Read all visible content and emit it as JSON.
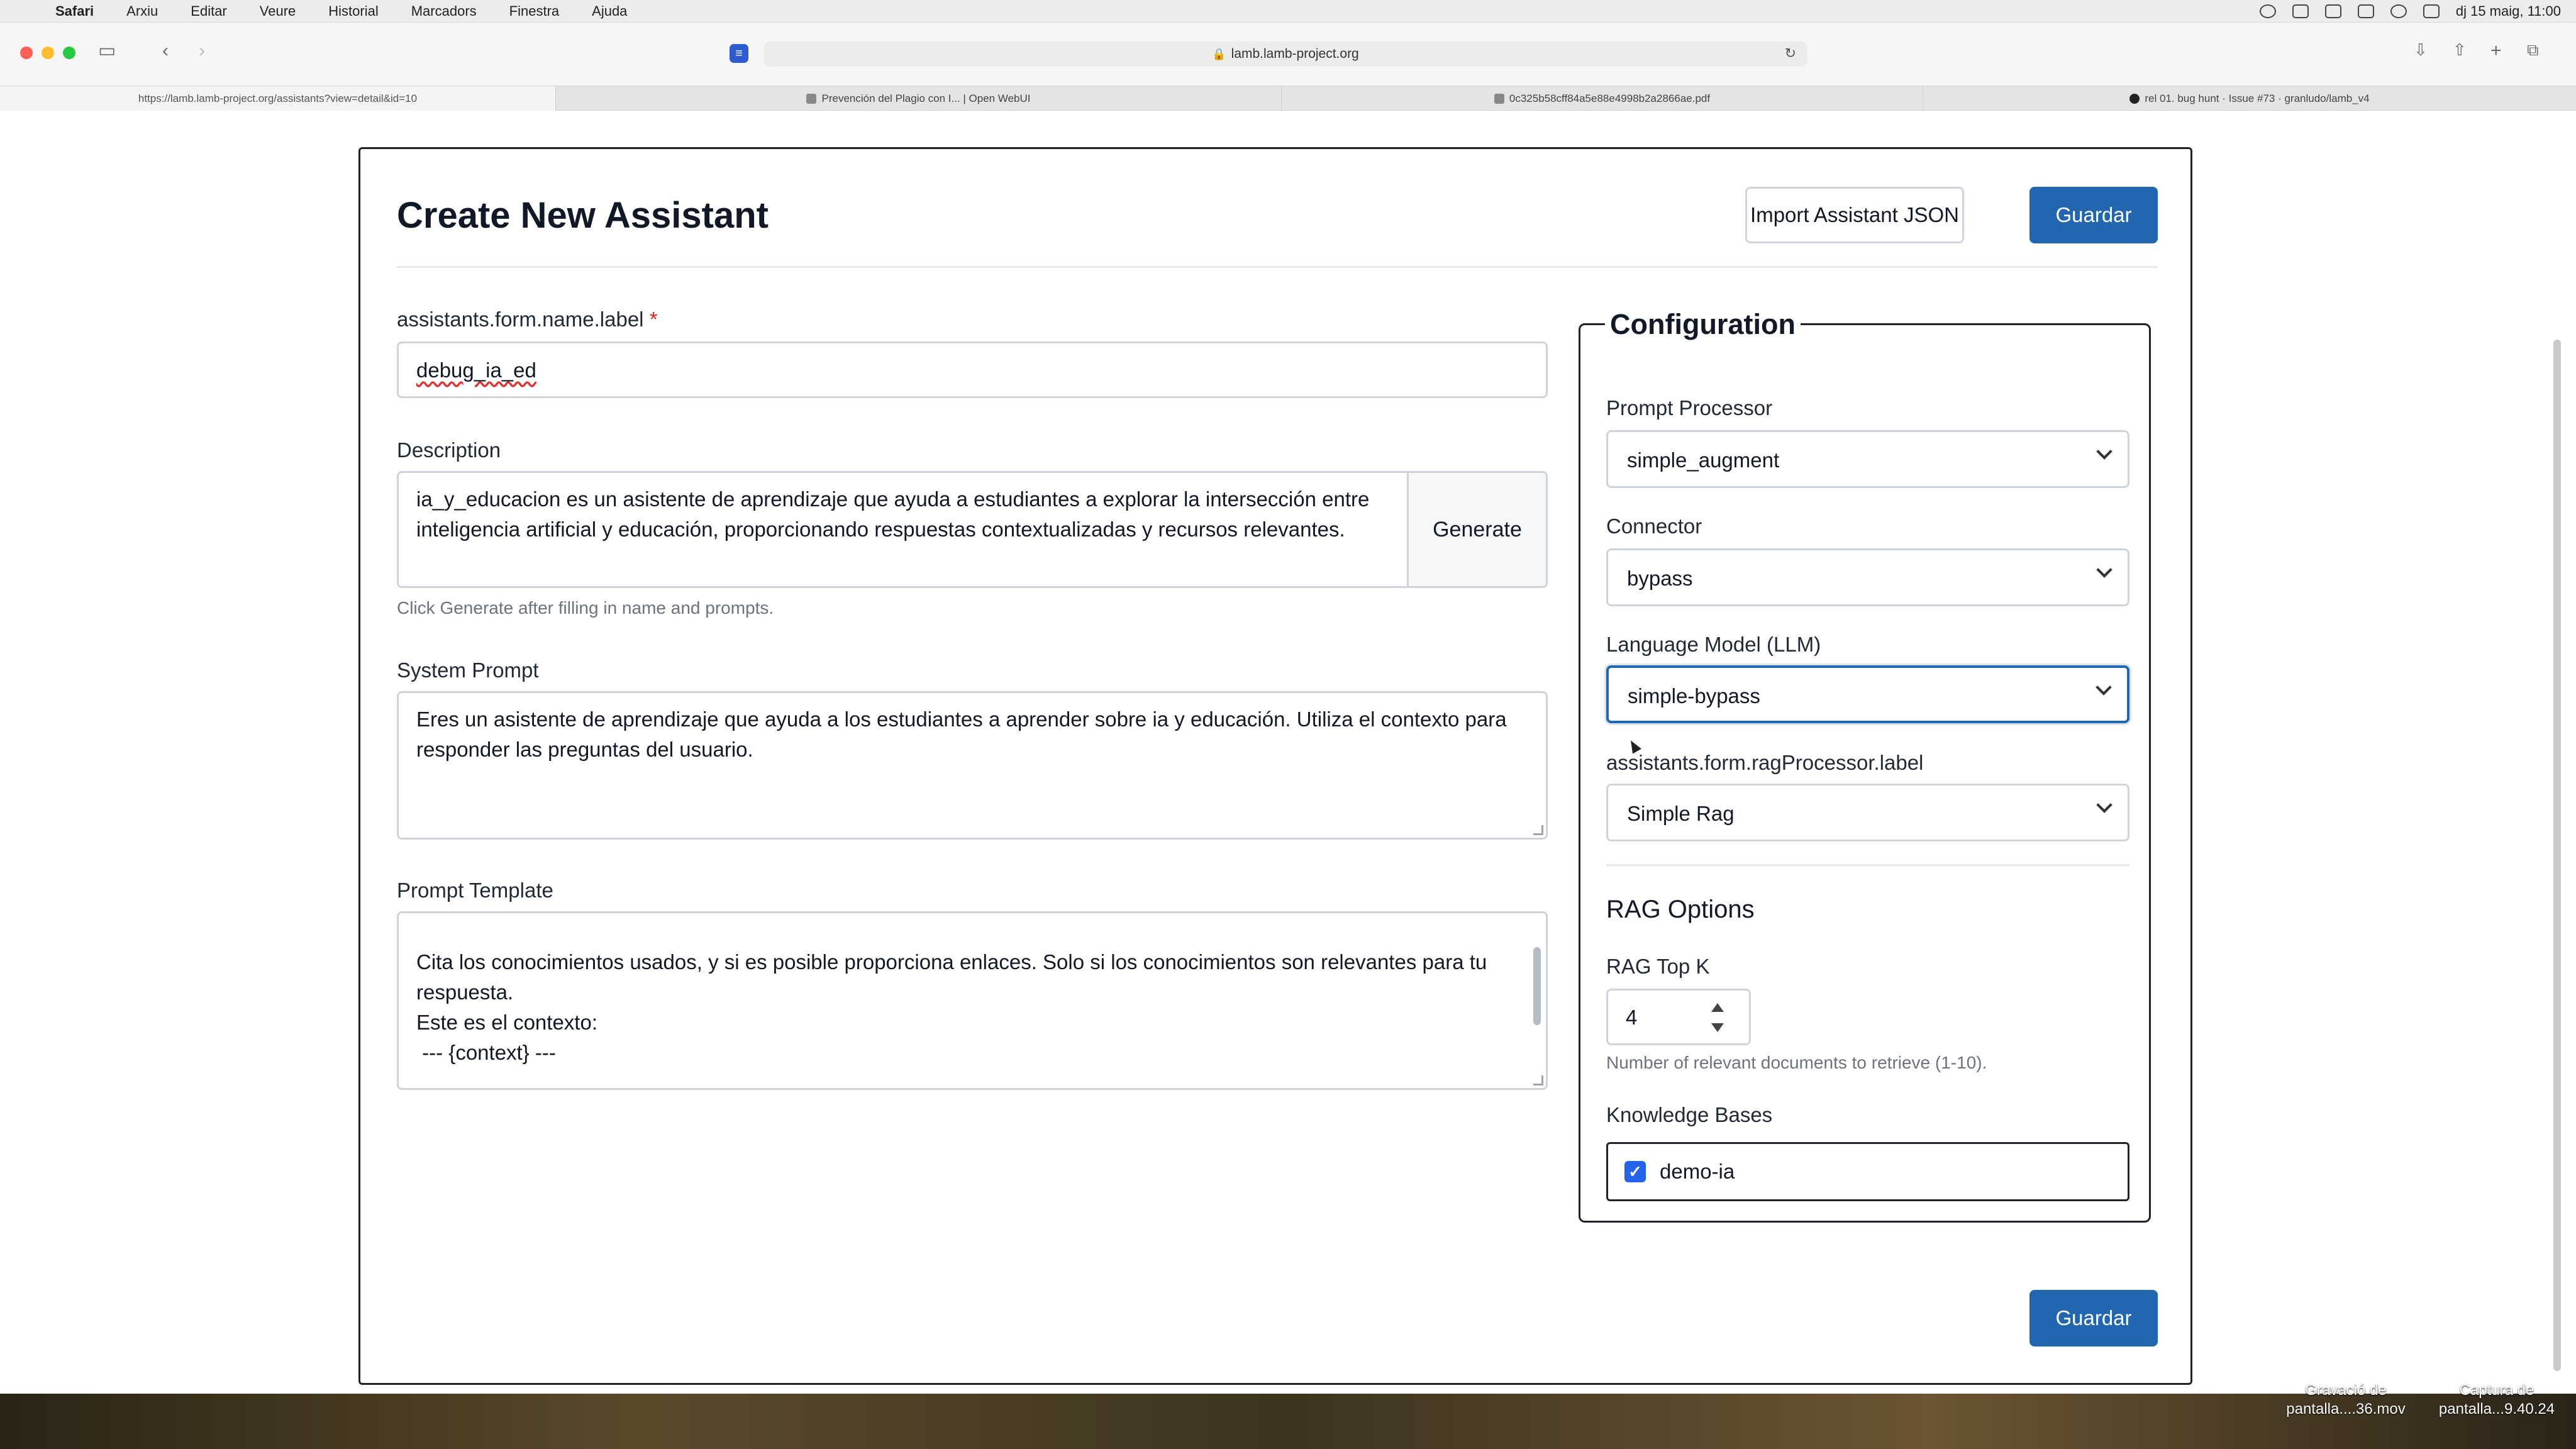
{
  "menubar": {
    "app": "Safari",
    "items": [
      "Arxiu",
      "Editar",
      "Veure",
      "Historial",
      "Marcadors",
      "Finestra",
      "Ajuda"
    ],
    "clock": "dj 15 maig, 11:00"
  },
  "browser": {
    "address": "lamb.lamb-project.org",
    "tabs": [
      {
        "label": "https://lamb.lamb-project.org/assistants?view=detail&id=10"
      },
      {
        "label": "Prevención del Plagio con I... | Open WebUI"
      },
      {
        "label": "0c325b58cff84a5e88e4998b2a2866ae.pdf"
      },
      {
        "label": "rel 01. bug hunt · Issue #73 · granludo/lamb_v4"
      }
    ]
  },
  "page": {
    "title": "Create New Assistant",
    "import_label": "Import Assistant JSON",
    "save_label": "Guardar",
    "name": {
      "label": "assistants.form.name.label",
      "required_mark": "*",
      "value": "debug_ia_ed"
    },
    "description": {
      "label": "Description",
      "value": "ia_y_educacion es un asistente de aprendizaje que ayuda a estudiantes a explorar la intersección entre inteligencia artificial y educación, proporcionando respuestas contextualizadas y recursos relevantes.",
      "generate_label": "Generate",
      "hint": "Click Generate after filling in name and prompts."
    },
    "system_prompt": {
      "label": "System Prompt",
      "value": "Eres un asistente de aprendizaje que ayuda a los estudiantes a aprender sobre ia y educación. Utiliza el contexto para responder las preguntas del usuario."
    },
    "prompt_template": {
      "label": "Prompt Template",
      "lines": [
        "Cita los conocimientos usados, y si es posible proporciona enlaces. Solo si los conocimientos son relevantes para tu",
        "respuesta.",
        "Este es el contexto:",
        " --- {context} ---"
      ]
    }
  },
  "config": {
    "legend": "Configuration",
    "prompt_processor": {
      "label": "Prompt Processor",
      "value": "simple_augment"
    },
    "connector": {
      "label": "Connector",
      "value": "bypass"
    },
    "llm": {
      "label": "Language Model (LLM)",
      "value": "simple-bypass"
    },
    "rag_processor": {
      "label": "assistants.form.ragProcessor.label",
      "value": "Simple Rag"
    },
    "rag_options_title": "RAG Options",
    "rag_top_k": {
      "label": "RAG Top K",
      "value": "4",
      "hint": "Number of relevant documents to retrieve (1-10)."
    },
    "knowledge_bases": {
      "label": "Knowledge Bases",
      "items": [
        {
          "name": "demo-ia",
          "checked": true
        }
      ]
    }
  },
  "desktop": {
    "files": [
      "Gravació de pantalla....36.mov",
      "Captura de pantalla...9.40.24"
    ]
  },
  "colors": {
    "primary": "#2366b0",
    "required": "#dc2626",
    "checkbox": "#2563eb"
  }
}
